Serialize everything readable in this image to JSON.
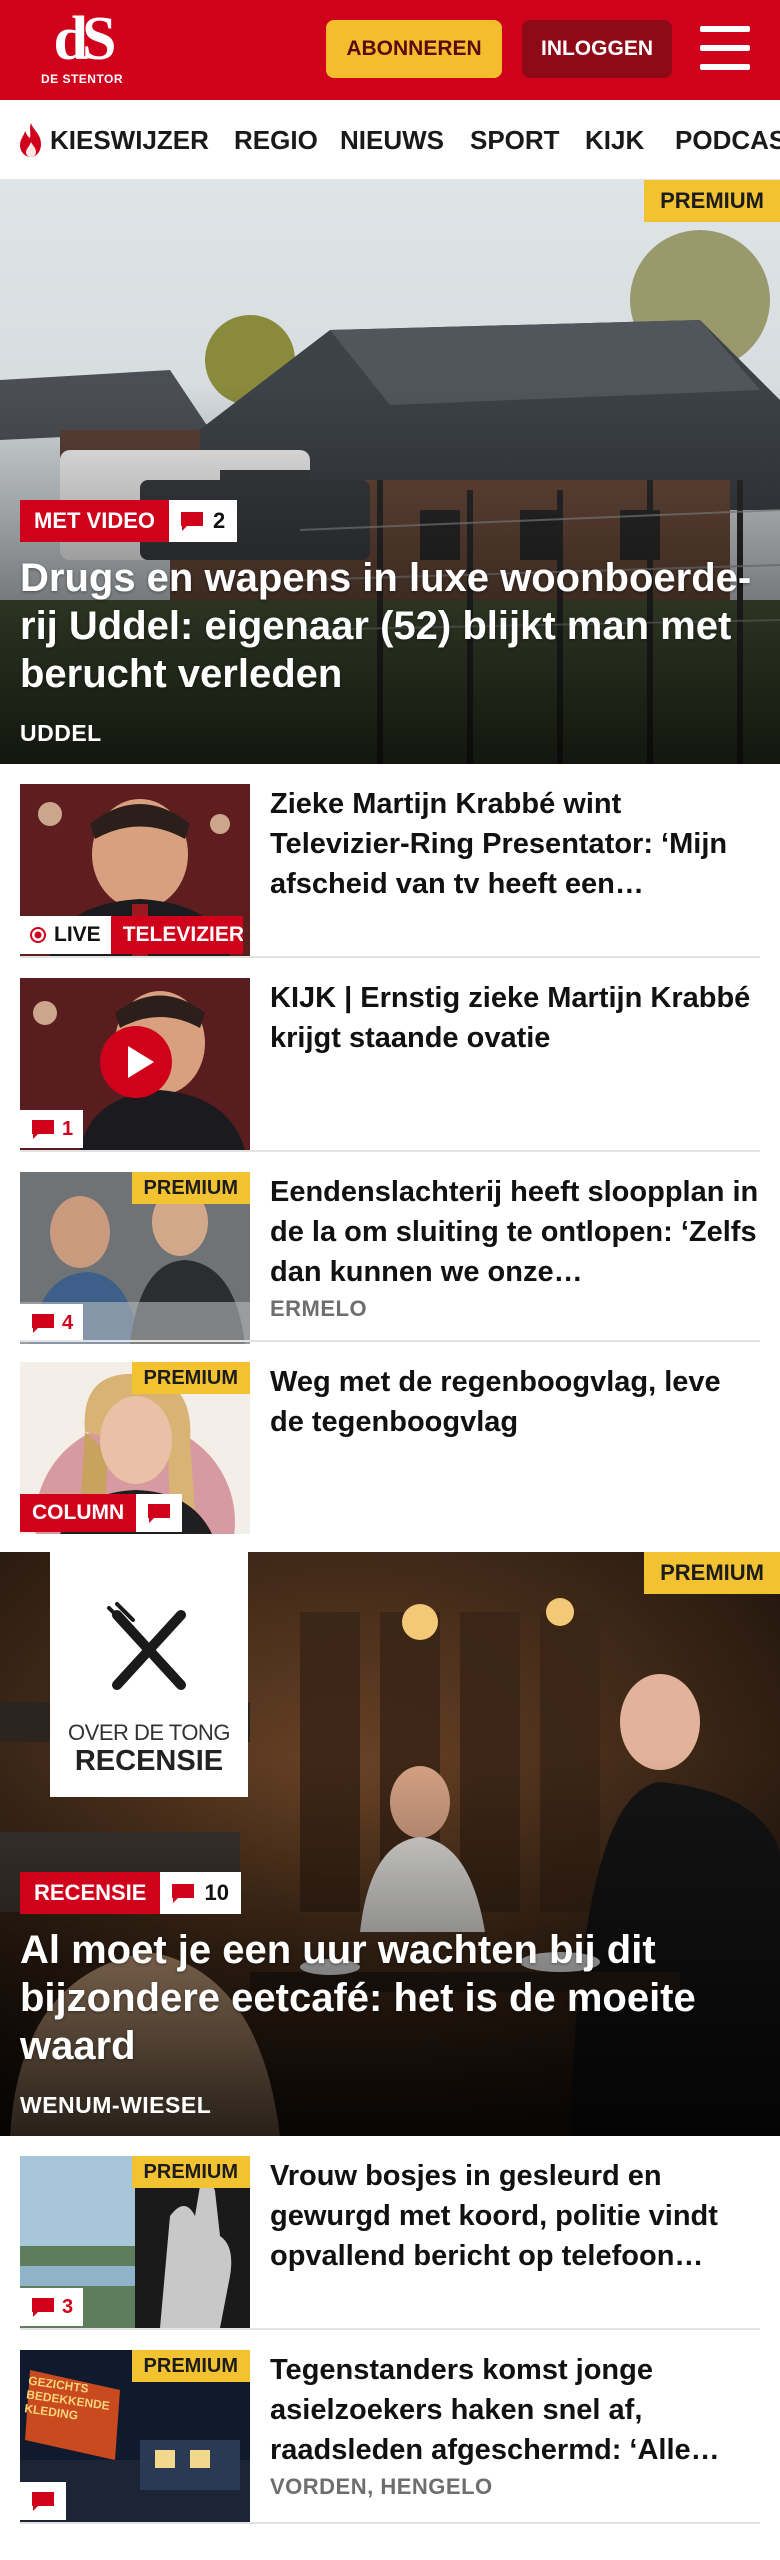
{
  "brand": {
    "logo_text": "dS",
    "logo_subtitle": "DE STENTOR"
  },
  "header": {
    "subscribe_label": "ABONNEREN",
    "login_label": "INLOGGEN",
    "menu_icon": "hamburger-menu-icon"
  },
  "nav": {
    "items": [
      {
        "label": "KIESWIJZER",
        "icon": "flame-icon"
      },
      {
        "label": "REGIO"
      },
      {
        "label": "NIEUWS"
      },
      {
        "label": "SPORT"
      },
      {
        "label": "KIJK"
      },
      {
        "label": "PODCAST"
      }
    ]
  },
  "hero1": {
    "premium_label": "PREMIUM",
    "tag": "MET VIDEO",
    "comments": "2",
    "title": "Drugs en wapens in luxe woonboerde-rij Uddel: eigenaar (52) blijkt man met berucht verleden",
    "place": "UDDEL"
  },
  "articles_a": [
    {
      "title": "Zieke Martijn Krabbé wint Televizier-Ring Presentator: ‘Mijn afscheid van tv heeft een…",
      "live_label": "LIVE",
      "label": "TELEVIZIER-RING"
    },
    {
      "title": "KIJK | Ernstig zieke Martijn Krabbé krijgt staande ovatie",
      "comments": "1"
    },
    {
      "title": "Eendenslachterij heeft sloopplan in de la om sluiting te ontlopen: ‘Zelfs dan kunnen we onze…",
      "premium_label": "PREMIUM",
      "comments": "4",
      "place": "ERMELO"
    },
    {
      "title": "Weg met de regenboogvlag, leve de tegenboogvlag",
      "premium_label": "PREMIUM",
      "label": "COLUMN"
    }
  ],
  "hero2": {
    "premium_label": "PREMIUM",
    "logo_line1": "OVER DE TONG",
    "logo_line2": "RECENSIE",
    "tag": "RECENSIE",
    "comments": "10",
    "title": "Al moet je een uur wachten bij dit bijzondere eetcafé: het is de moeite waard",
    "place": "WENUM-WIESEL"
  },
  "articles_b": [
    {
      "title": "Vrouw bosjes in gesleurd en gewurgd met koord, politie vindt opvallend bericht op telefoon…",
      "premium_label": "PREMIUM",
      "comments": "3"
    },
    {
      "title": "Tegenstanders komst jonge asielzoekers haken snel af, raadsleden afgeschermd: ‘Alle…",
      "premium_label": "PREMIUM",
      "place": "VORDEN, HENGELO",
      "sign_text": "GEZICHTS BEDEKKENDE KLEDING"
    }
  ],
  "colors": {
    "brand_red": "#d0021b",
    "premium_yellow": "#f2c230",
    "subscribe_yellow": "#f4bd2c",
    "login_dark_red": "#8e0a17"
  }
}
